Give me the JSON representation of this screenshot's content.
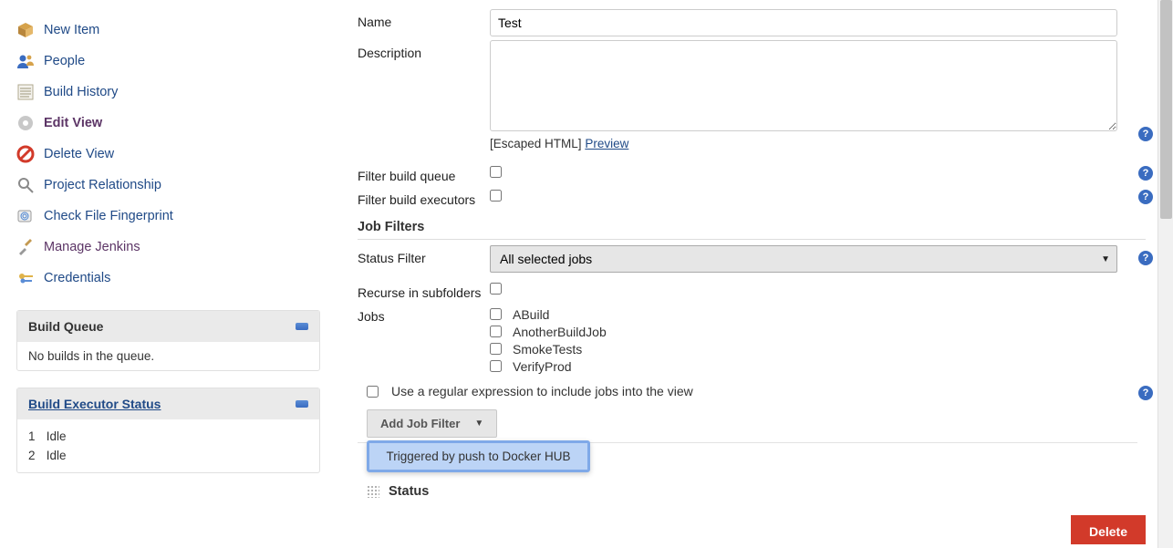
{
  "sidebar": {
    "items": [
      {
        "label": "New Item"
      },
      {
        "label": "People"
      },
      {
        "label": "Build History"
      },
      {
        "label": "Edit View"
      },
      {
        "label": "Delete View"
      },
      {
        "label": "Project Relationship"
      },
      {
        "label": "Check File Fingerprint"
      },
      {
        "label": "Manage Jenkins"
      },
      {
        "label": "Credentials"
      }
    ]
  },
  "build_queue": {
    "title": "Build Queue",
    "empty_text": "No builds in the queue."
  },
  "executor_status": {
    "title": "Build Executor Status",
    "rows": [
      {
        "num": "1",
        "state": "Idle"
      },
      {
        "num": "2",
        "state": "Idle"
      }
    ]
  },
  "form": {
    "name_label": "Name",
    "name_value": "Test",
    "description_label": "Description",
    "description_value": "",
    "escaped_html": "[Escaped HTML]",
    "preview": "Preview",
    "filter_queue_label": "Filter build queue",
    "filter_executors_label": "Filter build executors",
    "job_filters_title": "Job Filters",
    "status_filter_label": "Status Filter",
    "status_filter_value": "All selected jobs",
    "recurse_label": "Recurse in subfolders",
    "jobs_label": "Jobs",
    "jobs": [
      "ABuild",
      "AnotherBuildJob",
      "SmokeTests",
      "VerifyProd"
    ],
    "regex_label": "Use a regular expression to include jobs into the view",
    "add_filter_label": "Add Job Filter",
    "dropdown_item": "Triggered by push to Docker HUB",
    "status_label": "Status",
    "delete_label": "Delete"
  }
}
